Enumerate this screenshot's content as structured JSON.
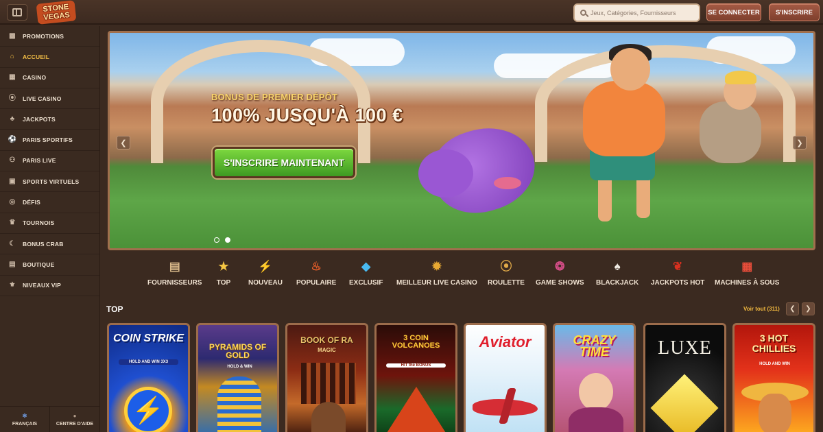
{
  "header": {
    "logo_text": "STONE VEGAS",
    "search_placeholder": "Jeux, Catégories, Fournisseurs",
    "login_label": "Se connecter",
    "register_label": "S'inscrire"
  },
  "sidebar": {
    "items": [
      {
        "label": "Promotions",
        "icon": "gift-icon"
      },
      {
        "label": "Accueil",
        "icon": "home-icon",
        "active": true
      },
      {
        "label": "Casino",
        "icon": "slot-machine-icon"
      },
      {
        "label": "Live Casino",
        "icon": "chip-icon"
      },
      {
        "label": "Jackpots",
        "icon": "clover-icon"
      },
      {
        "label": "Paris sportifs",
        "icon": "ball-icon"
      },
      {
        "label": "Paris live",
        "icon": "live-person-icon"
      },
      {
        "label": "Sports virtuels",
        "icon": "screen-icon"
      },
      {
        "label": "Défis",
        "icon": "target-icon"
      },
      {
        "label": "Tournois",
        "icon": "trophy-icon"
      },
      {
        "label": "Bonus Crab",
        "icon": "crab-icon"
      },
      {
        "label": "Boutique",
        "icon": "shop-icon"
      },
      {
        "label": "Niveaux VIP",
        "icon": "vip-icon"
      }
    ],
    "language_label": "Français",
    "help_label": "Centre d'aide"
  },
  "banner": {
    "subtitle": "Bonus de premier dépôt",
    "headline": "100% jusqu'à 100 €",
    "cta_label": "S'inscrire maintenant",
    "slide_count": 2,
    "active_slide": 2
  },
  "categories": [
    {
      "label": "Fournisseurs",
      "icon": "scroll-icon"
    },
    {
      "label": "Top",
      "icon": "star-icon"
    },
    {
      "label": "Nouveau",
      "icon": "lightning-icon"
    },
    {
      "label": "Populaire",
      "icon": "fire-icon"
    },
    {
      "label": "Exclusif",
      "icon": "diamond-icon"
    },
    {
      "label": "Meilleur live casino",
      "icon": "medal-icon"
    },
    {
      "label": "Roulette",
      "icon": "roulette-icon"
    },
    {
      "label": "Game shows",
      "icon": "wheel-icon"
    },
    {
      "label": "Blackjack",
      "icon": "cards-icon"
    },
    {
      "label": "Jackpots hot",
      "icon": "chili-icon"
    },
    {
      "label": "Machines à sous",
      "icon": "slot-icon"
    }
  ],
  "top_section": {
    "title": "Top",
    "view_all_label": "Voir tout (311)",
    "games": [
      {
        "name": "COIN STRIKE",
        "sub": "HOLD AND WIN 3X3"
      },
      {
        "name": "PYRAMIDS OF GOLD",
        "sub": "HOLD & WIN"
      },
      {
        "name": "BOOK OF RA",
        "sub": "MAGIC"
      },
      {
        "name": "3 COIN VOLCANOES",
        "sub": "HIT the BONUS"
      },
      {
        "name": "Aviator",
        "sub": ""
      },
      {
        "name": "CRAZY TIME",
        "sub": ""
      },
      {
        "name": "LUXE",
        "sub": ""
      },
      {
        "name": "3 HOT CHILLIES",
        "sub": "HOLD AND WIN"
      }
    ]
  }
}
